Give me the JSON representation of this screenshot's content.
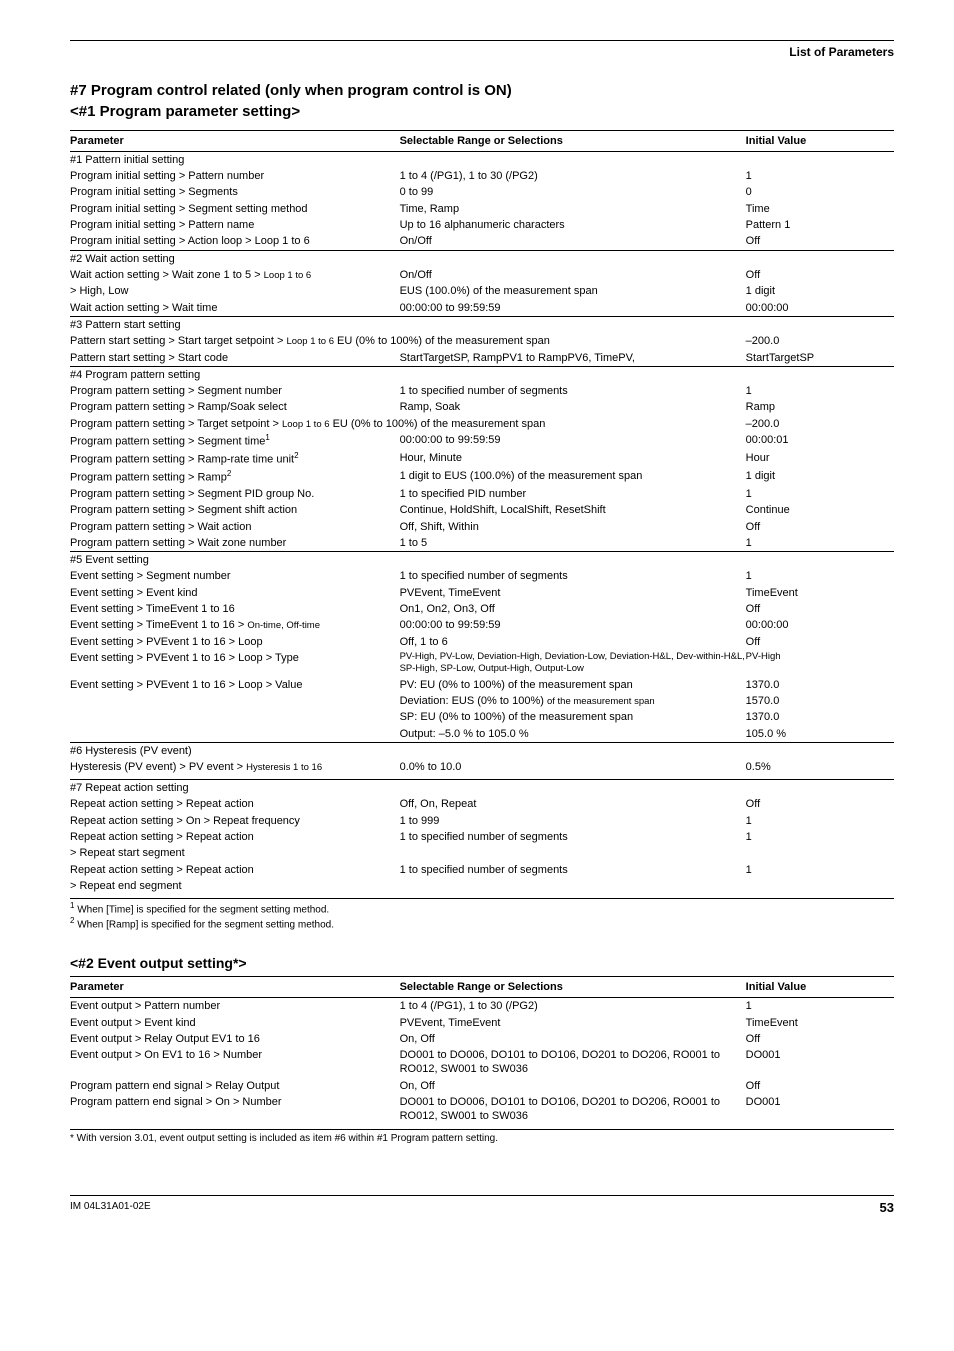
{
  "section_label": "List of Parameters",
  "heading_main": "#7 Program control related (only when program control is ON)",
  "heading_sub": "<#1 Program parameter setting>",
  "col_headers": {
    "param": "Parameter",
    "range": "Selectable Range or Selections",
    "init": "Initial Value"
  },
  "g1": {
    "title": "#1 Pattern initial setting",
    "r1": {
      "p": "Program initial setting > Pattern number",
      "r": "1 to 4 (/PG1), 1 to 30 (/PG2)",
      "i": "1"
    },
    "r2": {
      "p": "Program initial setting > Segments",
      "r": "0 to 99",
      "i": "0"
    },
    "r3": {
      "p": "Program initial setting > Segment setting method",
      "r": "Time, Ramp",
      "i": "Time"
    },
    "r4": {
      "p": "Program initial setting > Pattern name",
      "r": "Up to 16 alphanumeric characters",
      "i": "Pattern 1"
    },
    "r5": {
      "p": "Program initial setting > Action loop > Loop 1 to 6",
      "r": "On/Off",
      "i": "Off"
    }
  },
  "g2": {
    "title": "#2 Wait action setting",
    "r1": {
      "p_a": "Wait action setting > Wait zone 1 to 5 > ",
      "p_b": "Loop 1 to 6",
      "r": "On/Off",
      "i": "Off"
    },
    "r2": {
      "p": " > High, Low",
      "r": "EUS (100.0%) of the measurement span",
      "i": "1 digit"
    },
    "r3": {
      "p": "Wait action setting > Wait time",
      "r": "00:00:00 to 99:59:59",
      "i": "00:00:00"
    }
  },
  "g3": {
    "title": "#3 Pattern start setting",
    "r1": {
      "p_a": "Pattern start setting > Start target setpoint > ",
      "p_b": "Loop 1 to 6",
      "r": " EU (0% to 100%) of the measurement span",
      "i": "–200.0"
    },
    "r2": {
      "p": "Pattern start setting > Start code",
      "r": "StartTargetSP, RampPV1 to RampPV6, TimePV,",
      "i": "StartTargetSP"
    }
  },
  "g4": {
    "title": "#4 Program pattern setting",
    "r1": {
      "p": "Program pattern setting > Segment number",
      "r": "1 to specified number of segments",
      "i": "1"
    },
    "r2": {
      "p": "Program pattern setting > Ramp/Soak select",
      "r": "Ramp, Soak",
      "i": "Ramp"
    },
    "r3": {
      "p_a": "Program pattern setting > Target setpoint > ",
      "p_b": "Loop 1 to 6",
      "r": " EU (0% to 100%) of the measurement span",
      "i": "–200.0"
    },
    "r4": {
      "p": "Program pattern setting > Segment time",
      "sup": "1",
      "r": "00:00:00 to 99:59:59",
      "i": "00:00:01"
    },
    "r5": {
      "p": "Program pattern setting > Ramp-rate time unit",
      "sup": "2",
      "r": "Hour, Minute",
      "i": "Hour"
    },
    "r6": {
      "p": "Program pattern setting > Ramp",
      "sup": "2",
      "r": "1 digit to EUS (100.0%) of the measurement span",
      "i": "1 digit"
    },
    "r7": {
      "p": "Program pattern setting > Segment PID group No.",
      "r": "1 to specified PID number",
      "i": "1"
    },
    "r8": {
      "p": "Program pattern setting > Segment shift action",
      "r": "Continue, HoldShift, LocalShift, ResetShift",
      "i": "Continue"
    },
    "r9": {
      "p": "Program pattern setting > Wait action",
      "r": "Off, Shift, Within",
      "i": "Off"
    },
    "r10": {
      "p": "Program pattern setting > Wait zone number",
      "r": "1 to 5",
      "i": "1"
    }
  },
  "g5": {
    "title": "#5 Event setting",
    "r1": {
      "p": "Event setting > Segment number",
      "r": "1 to specified number of segments",
      "i": "1"
    },
    "r2": {
      "p": "Event setting > Event kind",
      "r": "PVEvent, TimeEvent",
      "i": "TimeEvent"
    },
    "r3": {
      "p": "Event setting > TimeEvent 1 to 16",
      "r": "On1, On2, On3, Off",
      "i": "Off"
    },
    "r4": {
      "p_a": "Event setting > TimeEvent 1 to 16 > ",
      "p_b": "On-time, Off-time",
      "r": "00:00:00 to 99:59:59",
      "i": "00:00:00"
    },
    "r5": {
      "p": "Event setting > PVEvent 1 to 16 > Loop",
      "r": "Off, 1 to 6",
      "i": "Off"
    },
    "r6": {
      "p": "Event setting > PVEvent 1 to 16 > Loop > Type",
      "r": "PV-High, PV-Low, Deviation-High, Deviation-Low, Deviation-H&L, Dev-within-H&L, SP-High, SP-Low, Output-High, Output-Low",
      "i": "PV-High"
    },
    "r7": {
      "p": "Event setting > PVEvent 1 to 16 > Loop > Value",
      "r_a": "PV:  EU (0% to 100%) of the measurement span",
      "i_a": "1370.0",
      "r_b_pre": "Deviation:  EUS (0% to 100%) ",
      "r_b_suf": "of the measurement span",
      "i_b": "1570.0",
      "r_c": "SP:  EU (0% to 100%) of the measurement span",
      "i_c": "1370.0",
      "r_d": "Output:  –5.0 % to 105.0 %",
      "i_d": "105.0 %"
    }
  },
  "g6": {
    "title": "#6 Hysteresis (PV event)",
    "r1": {
      "p_a": "Hysteresis (PV event) > PV event > ",
      "p_b": "Hysteresis 1 to 16",
      "r": "0.0% to 10.0",
      "i": "0.5%"
    }
  },
  "g7": {
    "title": "#7 Repeat action setting",
    "r1": {
      "p": "Repeat action setting > Repeat action",
      "r": "Off, On, Repeat",
      "i": "Off"
    },
    "r2": {
      "p": "Repeat action setting > On > Repeat frequency",
      "r": "1 to 999",
      "i": "1"
    },
    "r3a": {
      "p": "Repeat action setting > Repeat action",
      "r": "1 to specified number of segments",
      "i": "1"
    },
    "r3b": {
      "p": " > Repeat start segment"
    },
    "r4a": {
      "p": "Repeat action setting > Repeat action",
      "r": "1 to specified number of segments",
      "i": "1"
    },
    "r4b": {
      "p": " > Repeat end segment"
    }
  },
  "footnote1_pre": "1",
  "footnote1": " When [Time] is specified for the segment setting method.",
  "footnote2_pre": "2",
  "footnote2": " When [Ramp] is specified for the segment setting method.",
  "heading_sub2": "<#2 Event output setting*>",
  "t2": {
    "r1": {
      "p": "Event output > Pattern number",
      "r": "1 to 4 (/PG1), 1 to 30 (/PG2)",
      "i": "1"
    },
    "r2": {
      "p": "Event output > Event kind",
      "r": "PVEvent, TimeEvent",
      "i": "TimeEvent"
    },
    "r3": {
      "p": "Event output > Relay Output EV1 to 16",
      "r": "On, Off",
      "i": "Off"
    },
    "r4": {
      "p": "Event output > On EV1 to 16 > Number",
      "r": "DO001 to DO006, DO101 to DO106, DO201 to DO206, RO001 to RO012, SW001 to SW036",
      "i": "DO001"
    },
    "r5": {
      "p": "Program pattern end signal > Relay Output",
      "r": "On, Off",
      "i": "Off"
    },
    "r6": {
      "p": "Program pattern end signal > On > Number",
      "r": "DO001 to DO006, DO101 to DO106, DO201 to DO206, RO001 to RO012, SW001 to SW036",
      "i": "DO001"
    }
  },
  "bottom_note": "*  With version 3.01, event output setting is included as item #6 within #1 Program pattern setting.",
  "footer_left": "IM 04L31A01-02E",
  "footer_right": "53"
}
